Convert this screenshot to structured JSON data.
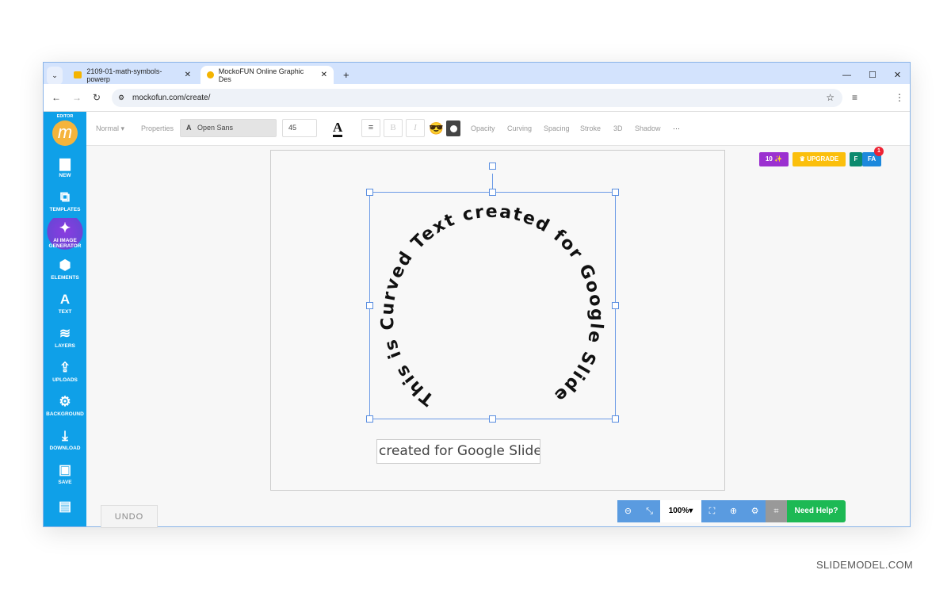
{
  "browser": {
    "tabs": [
      {
        "title": "2109-01-math-symbols-powerp"
      },
      {
        "title": "MockoFUN Online Graphic Des"
      }
    ],
    "url": "mockofun.com/create/"
  },
  "sidebar": {
    "editor_label": "EDITOR",
    "items": [
      {
        "label": "NEW",
        "icon": "file-icon",
        "glyph": "▆"
      },
      {
        "label": "TEMPLATES",
        "icon": "templates-icon",
        "glyph": "⧉"
      },
      {
        "label": "AI IMAGE GENERATOR",
        "icon": "sparkle-icon",
        "glyph": "✦"
      },
      {
        "label": "ELEMENTS",
        "icon": "cubes-icon",
        "glyph": "⬢"
      },
      {
        "label": "TEXT",
        "icon": "text-icon",
        "glyph": "A"
      },
      {
        "label": "LAYERS",
        "icon": "layers-icon",
        "glyph": "≋"
      },
      {
        "label": "UPLOADS",
        "icon": "upload-icon",
        "glyph": "⇪"
      },
      {
        "label": "BACKGROUND",
        "icon": "gear-icon",
        "glyph": "⚙"
      },
      {
        "label": "DOWNLOAD",
        "icon": "download-icon",
        "glyph": "⤓"
      },
      {
        "label": "SAVE",
        "icon": "save-icon",
        "glyph": "▣"
      },
      {
        "label": "",
        "icon": "book-icon",
        "glyph": "▤"
      }
    ]
  },
  "toolbar": {
    "mode": "Normal ▾",
    "properties": "Properties",
    "font": "Open Sans",
    "font_size": "45",
    "bold": "B",
    "italic": "I",
    "items": [
      "Opacity",
      "Curving",
      "Spacing",
      "Stroke",
      "3D",
      "Shadow"
    ],
    "more": "···"
  },
  "badges": {
    "credits": "10 ✨",
    "upgrade": "♛ UPGRADE",
    "user_f": "F",
    "user_fa": "FA",
    "notifications": "1"
  },
  "canvas": {
    "curved_text": "This is Curved Text created for Google Slides",
    "edit_value": "created for Google Slides"
  },
  "undo": "UNDO",
  "zoom": {
    "level": "100%▾",
    "help": "Need Help?"
  },
  "colors": {
    "sidebar": "#0fa0e8",
    "help": "#1db954",
    "zoom": "#5a9be0",
    "upgrade": "#fbbf0c",
    "credits": "#9b30d0"
  },
  "watermark": "SLIDEMODEL.COM"
}
